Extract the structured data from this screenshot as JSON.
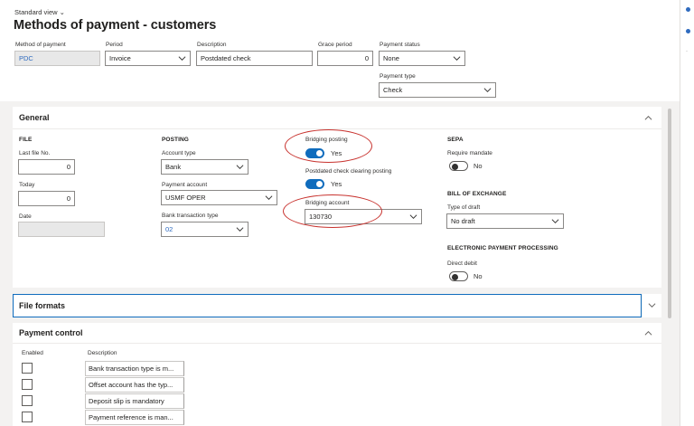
{
  "header": {
    "view": "Standard view",
    "title": "Methods of payment - customers"
  },
  "top_fields": {
    "method_label": "Method of payment",
    "method_value": "PDC",
    "period_label": "Period",
    "period_value": "Invoice",
    "description_label": "Description",
    "description_value": "Postdated check",
    "grace_label": "Grace period",
    "grace_value": "0",
    "status_label": "Payment status",
    "status_value": "None",
    "type_label": "Payment type",
    "type_value": "Check"
  },
  "general": {
    "title": "General",
    "file": {
      "heading": "FILE",
      "last_file_label": "Last file No.",
      "last_file_value": "0",
      "today_label": "Today",
      "today_value": "0",
      "date_label": "Date",
      "date_value": ""
    },
    "posting": {
      "heading": "POSTING",
      "account_type_label": "Account type",
      "account_type_value": "Bank",
      "payment_account_label": "Payment account",
      "payment_account_value": "USMF OPER",
      "bank_tx_label": "Bank transaction type",
      "bank_tx_value": "02"
    },
    "bridging": {
      "posting_label": "Bridging posting",
      "posting_state": "Yes",
      "pdc_label": "Postdated check clearing posting",
      "pdc_state": "Yes",
      "account_label": "Bridging account",
      "account_value": "130730"
    },
    "sepa": {
      "heading": "SEPA",
      "mandate_label": "Require mandate",
      "mandate_state": "No"
    },
    "boe": {
      "heading": "BILL OF EXCHANGE",
      "draft_label": "Type of draft",
      "draft_value": "No draft"
    },
    "epp": {
      "heading": "ELECTRONIC PAYMENT PROCESSING",
      "direct_label": "Direct debit",
      "direct_state": "No"
    }
  },
  "file_formats": {
    "title": "File formats"
  },
  "payment_control": {
    "title": "Payment control",
    "col_enabled": "Enabled",
    "col_description": "Description",
    "rows": [
      "Bank transaction type is m...",
      "Offset account has the typ...",
      "Deposit slip is mandatory",
      "Payment reference is man..."
    ]
  },
  "colors": {
    "accent": "#0f6cbd",
    "highlight": "#c8332f",
    "link": "#2f6bbf"
  },
  "icons": [
    "chevron-down-icon",
    "chevron-up-icon"
  ]
}
